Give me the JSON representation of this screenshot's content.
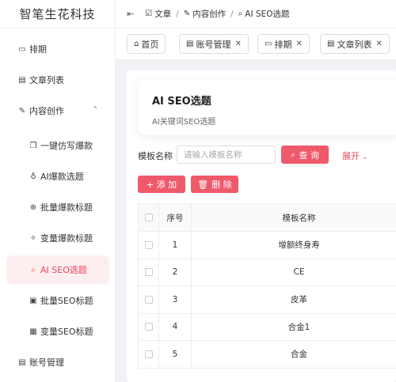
{
  "app": {
    "title": "智笔生花科技"
  },
  "sidebar": {
    "items": [
      {
        "label": "排期",
        "icon": "calendar-icon"
      },
      {
        "label": "文章列表",
        "icon": "document-icon"
      },
      {
        "label": "内容创作",
        "icon": "pen-icon",
        "expanded": true
      },
      {
        "label": "一键仿写爆款",
        "icon": "copy-icon"
      },
      {
        "label": "AI爆款选题",
        "icon": "lightbulb-icon"
      },
      {
        "label": "批量爆款标题",
        "icon": "plus-circle-icon"
      },
      {
        "label": "变量爆款标题",
        "icon": "magic-icon"
      },
      {
        "label": "AI SEO选题",
        "icon": "search-icon",
        "active": true
      },
      {
        "label": "批量SEO标题",
        "icon": "batch-doc-icon"
      },
      {
        "label": "变量SEO标题",
        "icon": "variable-doc-icon"
      },
      {
        "label": "账号管理",
        "icon": "account-icon"
      }
    ]
  },
  "breadcrumb": {
    "items": [
      "文章",
      "内容创作",
      "AI SEO选题"
    ]
  },
  "tabs": [
    {
      "label": "首页",
      "icon": "home-icon",
      "closable": false
    },
    {
      "label": "账号管理",
      "icon": "account-icon",
      "closable": true
    },
    {
      "label": "排期",
      "icon": "calendar-icon",
      "closable": true
    },
    {
      "label": "文章列表",
      "icon": "document-icon",
      "closable": true
    }
  ],
  "intro": {
    "title": "AI SEO选题",
    "subtitle": "AI关键词SEO选题"
  },
  "search": {
    "label": "模板名称",
    "placeholder": "请输入模板名称",
    "value": "",
    "query_label": "查 询",
    "expand_label": "展开"
  },
  "toolbar": {
    "add_label": "+ 添 加",
    "delete_label": "删 除"
  },
  "table": {
    "columns": [
      "序号",
      "模板名称"
    ],
    "rows": [
      {
        "index": "1",
        "name": "增额终身寿"
      },
      {
        "index": "2",
        "name": "CE"
      },
      {
        "index": "3",
        "name": "皮革"
      },
      {
        "index": "4",
        "name": "合金1"
      },
      {
        "index": "5",
        "name": "合金"
      }
    ]
  },
  "colors": {
    "accent": "#ef5a6b",
    "active_bg": "#fdeef0",
    "active_text": "#e8485e"
  }
}
